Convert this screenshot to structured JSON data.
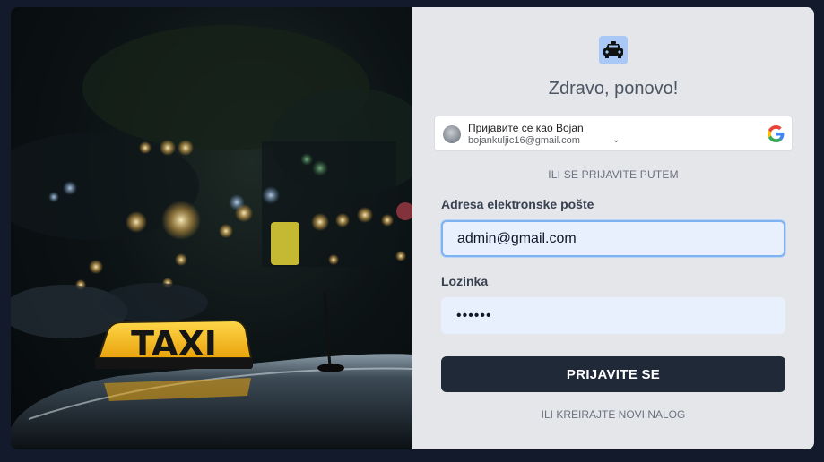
{
  "welcome_title": "Zdravo, ponovo!",
  "google_signin": {
    "name_line": "Пријавите се као Bojan",
    "email": "bojankuljic16@gmail.com",
    "chevron": "⌄"
  },
  "divider_text": "ILI SE PRIJAVITE PUTEM",
  "email_field": {
    "label": "Adresa elektronske pošte",
    "value": "admin@gmail.com"
  },
  "password_field": {
    "label": "Lozinka",
    "value": "••••••"
  },
  "submit_label": "PRIJAVITE SE",
  "register_link": "ILI KREIRAJTE NOVI NALOG",
  "photo": {
    "taxi_sign_text": "TAXI"
  },
  "icons": [
    "taxi-logo-icon",
    "google-icon",
    "avatar-icon",
    "chevron-down-icon"
  ],
  "colors": {
    "page_bg": "#121a2b",
    "panel_bg": "#e5e6e9",
    "button_bg": "#1f2937",
    "input_bg": "#e8f0fe",
    "focus_border": "#7eb2f0",
    "logo_bg": "#a9c8f5",
    "taxi_sign": "#f5c21a"
  }
}
